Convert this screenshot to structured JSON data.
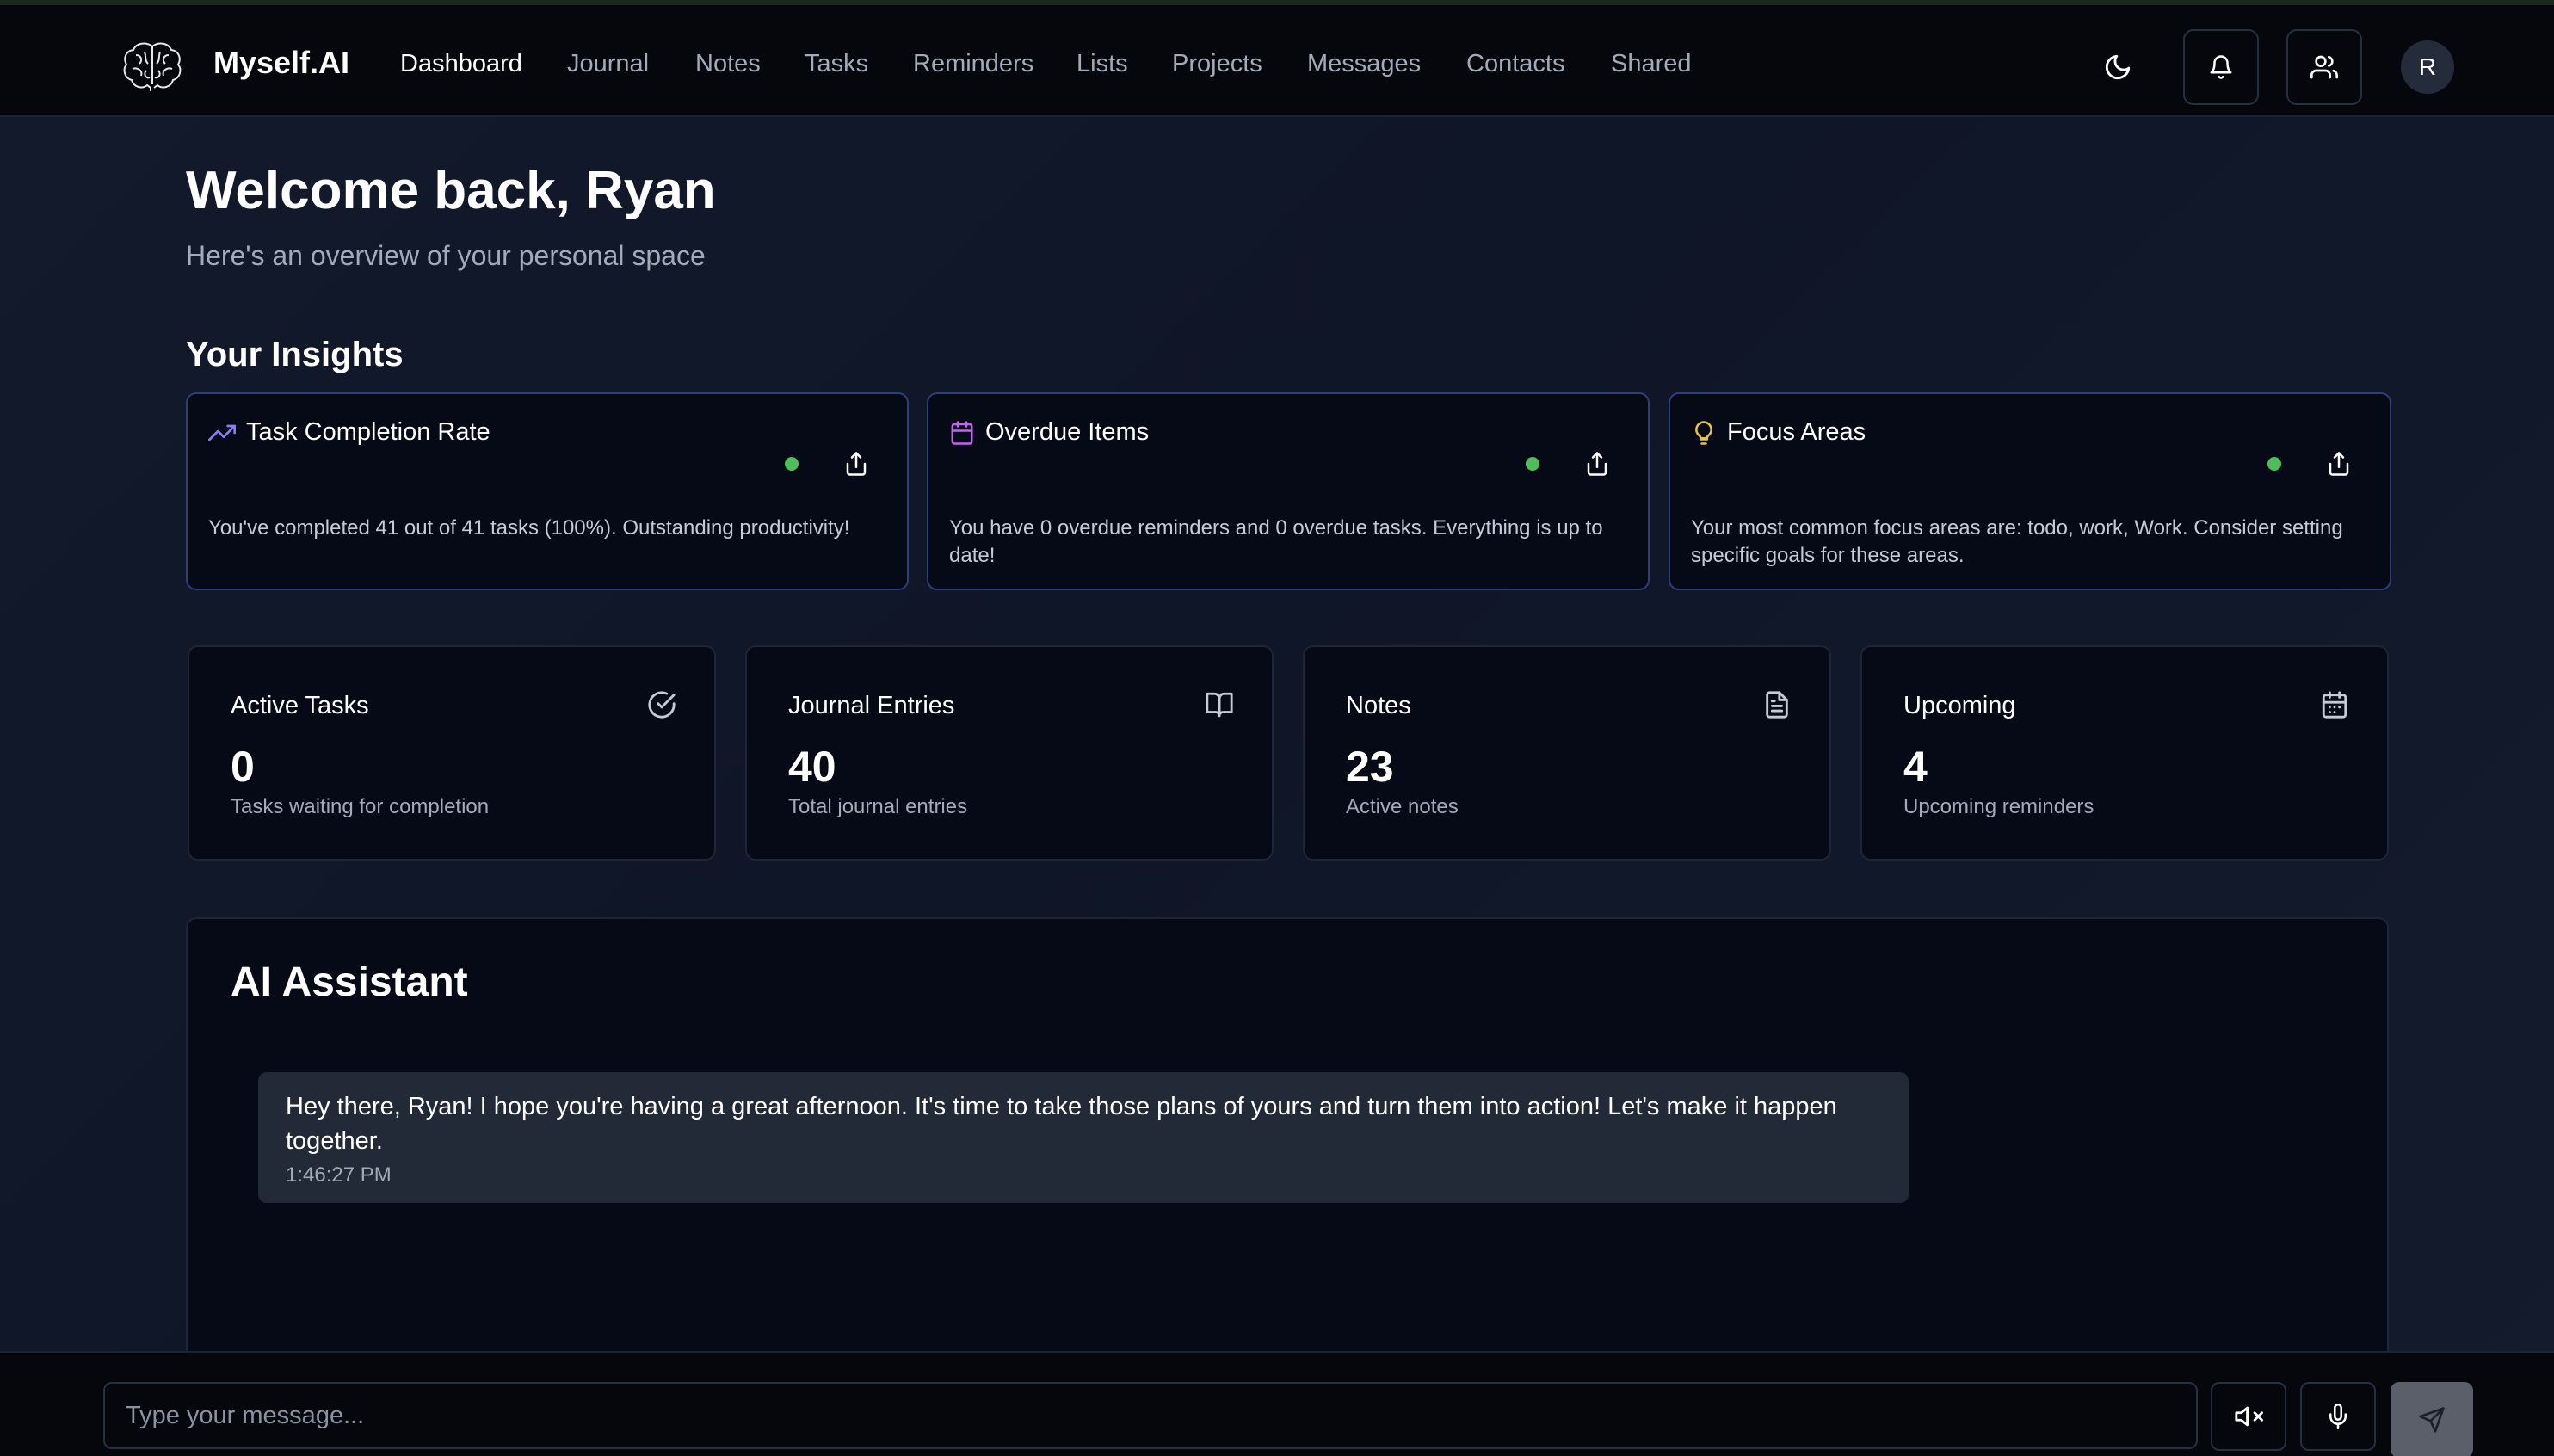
{
  "brand": {
    "name": "Myself.AI"
  },
  "nav": {
    "items": [
      {
        "label": "Dashboard",
        "active": true
      },
      {
        "label": "Journal",
        "active": false
      },
      {
        "label": "Notes",
        "active": false
      },
      {
        "label": "Tasks",
        "active": false
      },
      {
        "label": "Reminders",
        "active": false
      },
      {
        "label": "Lists",
        "active": false
      },
      {
        "label": "Projects",
        "active": false
      },
      {
        "label": "Messages",
        "active": false
      },
      {
        "label": "Contacts",
        "active": false
      },
      {
        "label": "Shared",
        "active": false
      }
    ],
    "icons": [
      "moon-icon",
      "bell-icon",
      "users-icon"
    ],
    "avatar_initial": "R"
  },
  "header": {
    "title": "Welcome back, Ryan",
    "subtitle": "Here's an overview of your personal space"
  },
  "insights": {
    "title": "Your Insights",
    "cards": [
      {
        "icon": "trending-up-icon",
        "icon_color": "#8b7cf6",
        "title": "Task Completion Rate",
        "text": "You've completed 41 out of 41 tasks (100%). Outstanding productivity!"
      },
      {
        "icon": "calendar-icon",
        "icon_color": "#c064f0",
        "title": "Overdue Items",
        "text": "You have 0 overdue reminders and 0 overdue tasks. Everything is up to date!"
      },
      {
        "icon": "lightbulb-icon",
        "icon_color": "#e8c14a",
        "title": "Focus Areas",
        "text": "Your most common focus areas are: todo, work, Work. Consider setting specific goals for these areas."
      }
    ],
    "status_color": "#4fbd5a"
  },
  "stats": [
    {
      "label": "Active Tasks",
      "value": "0",
      "desc": "Tasks waiting for completion",
      "icon": "check-circle-icon"
    },
    {
      "label": "Journal Entries",
      "value": "40",
      "desc": "Total journal entries",
      "icon": "book-open-icon"
    },
    {
      "label": "Notes",
      "value": "23",
      "desc": "Active notes",
      "icon": "file-text-icon"
    },
    {
      "label": "Upcoming",
      "value": "4",
      "desc": "Upcoming reminders",
      "icon": "calendar-icon"
    }
  ],
  "assistant": {
    "title": "AI Assistant",
    "message": {
      "text": "Hey there, Ryan! I hope you're having a great afternoon. It's time to take those plans of yours and turn them into action! Let's make it happen together.",
      "time": "1:46:27 PM"
    }
  },
  "composer": {
    "placeholder": "Type your message...",
    "value": "",
    "buttons": [
      "mute-icon",
      "mic-icon",
      "send-icon"
    ]
  }
}
